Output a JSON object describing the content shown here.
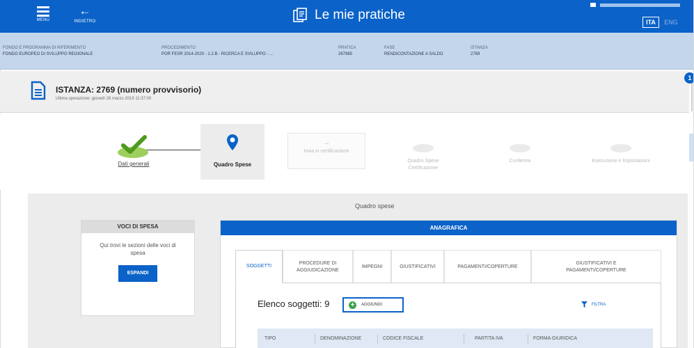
{
  "appbar": {
    "menu_label": "MENU",
    "back_label": "INDIETRO",
    "title": "Le mie pratiche",
    "lang_active": "ITA",
    "lang_other": "ENG"
  },
  "info": [
    {
      "label": "Fondo e programma di riferimento",
      "value": "FONDO EUROPEO DI SVILUPPO REGIONALE"
    },
    {
      "label": "Procedimento",
      "value": "POR FESR 2014-2020 - 1.2.B - RICERCA E SVILUPPO - ..."
    },
    {
      "label": "Pratica",
      "value": "267985"
    },
    {
      "label": "Fase",
      "value": "RENDICONTAZIONE A SALDO"
    },
    {
      "label": "Istanza",
      "value": "2769"
    }
  ],
  "istanza": {
    "title": "ISTANZA: 2769 (numero provvisorio)",
    "subtitle": "Ultima operazione: giovedì 28 marzo 2019 11:37:00",
    "badge": "1"
  },
  "stepper": {
    "steps": [
      {
        "label": "Dati generali",
        "state": "done"
      },
      {
        "label": "Quadro Spese",
        "state": "current"
      },
      {
        "label": "Invia in certificazione",
        "state": "disabled"
      },
      {
        "label": "Quadro Spese Certificazione",
        "state": "disabled"
      },
      {
        "label": "Conferma",
        "state": "disabled"
      },
      {
        "label": "Esecuzione e Impostazioni",
        "state": "disabled"
      }
    ]
  },
  "content": {
    "title": "Quadro spese",
    "voci": {
      "header": "Voci di spesa",
      "description": "Qui trovi le sezioni delle voci di spesa",
      "button": "ESPANDI"
    },
    "anagrafica": {
      "header": "ANAGRAFICA",
      "tabs": [
        "SOGGETTI",
        "PROCEDURE DI AGGIUDICAZIONE",
        "IMPEGNI",
        "GIUSTIFICATIVI",
        "PAGAMENTI/COPERTURE",
        "GIUSTIFICATIVI E PAGAMENTI/COPERTURE"
      ],
      "elenco": "Elenco soggetti: 9",
      "aggiungi": "AGGIUNGI",
      "filtra": "FILTRA",
      "columns": [
        "TIPO",
        "DENOMINAZIONE",
        "CODICE FISCALE",
        "PARTITA IVA",
        "FORMA GIURIDICA"
      ]
    }
  },
  "colors": {
    "primary": "#0b62c8",
    "info_strip": "#c4d6eb",
    "success": "#7cc13f"
  }
}
